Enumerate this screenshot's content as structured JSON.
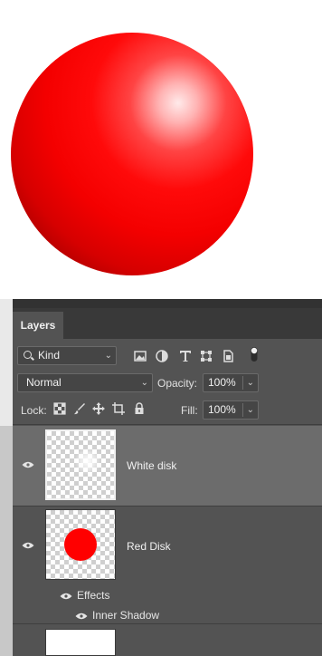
{
  "canvas": {
    "sphere_color": "#ff0000",
    "background": "#ffffff"
  },
  "panel": {
    "tab_label": "Layers",
    "filter": {
      "kind_label": "Kind",
      "icons": [
        "image-filter-icon",
        "adjustment-filter-icon",
        "type-filter-icon",
        "shape-filter-icon",
        "smart-object-filter-icon",
        "filter-toggle-icon"
      ]
    },
    "blend_mode": "Normal",
    "opacity_label": "Opacity:",
    "opacity_value": "100%",
    "lock_label": "Lock:",
    "lock_icons": [
      "lock-transparent-icon",
      "lock-image-icon",
      "lock-position-icon",
      "lock-artboard-icon",
      "lock-all-icon"
    ],
    "fill_label": "Fill:",
    "fill_value": "100%"
  },
  "layers": [
    {
      "name": "White disk",
      "selected": true,
      "visible": true
    },
    {
      "name": "Red Disk",
      "selected": false,
      "visible": true,
      "effects_label": "Effects",
      "effects": [
        "Inner Shadow"
      ]
    },
    {
      "name": "",
      "selected": false,
      "visible": true
    }
  ],
  "colors": {
    "panel_bg": "#535353",
    "selected_row": "#6c6c6c",
    "tab_bar": "#393939"
  }
}
